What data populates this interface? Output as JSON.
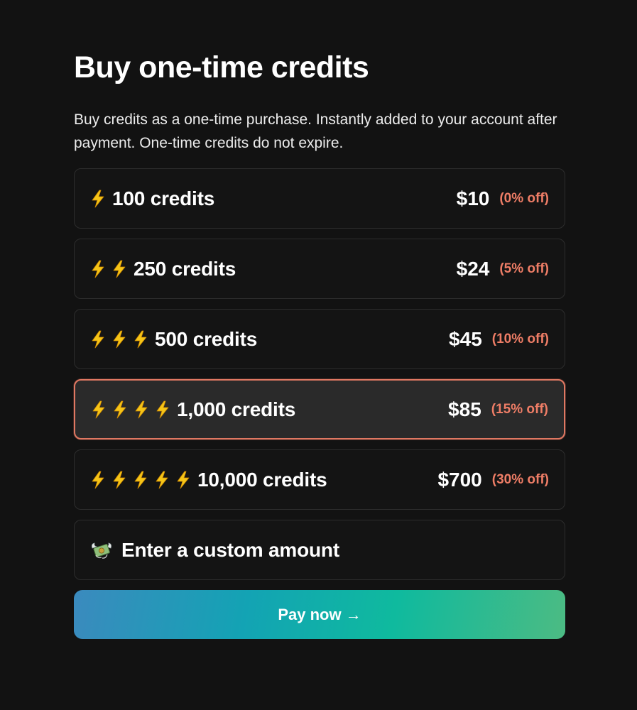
{
  "header": {
    "title": "Buy one-time credits",
    "description": "Buy credits as a one-time purchase. Instantly added to your account after payment. One-time credits do not expire."
  },
  "options": [
    {
      "bolts": 1,
      "label": "100 credits",
      "price": "$10",
      "discount": "(0% off)",
      "selected": false
    },
    {
      "bolts": 2,
      "label": "250 credits",
      "price": "$24",
      "discount": "(5% off)",
      "selected": false
    },
    {
      "bolts": 3,
      "label": "500 credits",
      "price": "$45",
      "discount": "(10% off)",
      "selected": false
    },
    {
      "bolts": 4,
      "label": "1,000 credits",
      "price": "$85",
      "discount": "(15% off)",
      "selected": true
    },
    {
      "bolts": 5,
      "label": "10,000 credits",
      "price": "$700",
      "discount": "(30% off)",
      "selected": false
    }
  ],
  "custom": {
    "icon": "money-with-wings-icon",
    "label": "Enter a custom amount"
  },
  "pay_button": {
    "label": "Pay now →"
  },
  "colors": {
    "background": "#121212",
    "accent": "#ee7d66",
    "selected_border": "#e07862",
    "bolt": "#f5c518"
  }
}
